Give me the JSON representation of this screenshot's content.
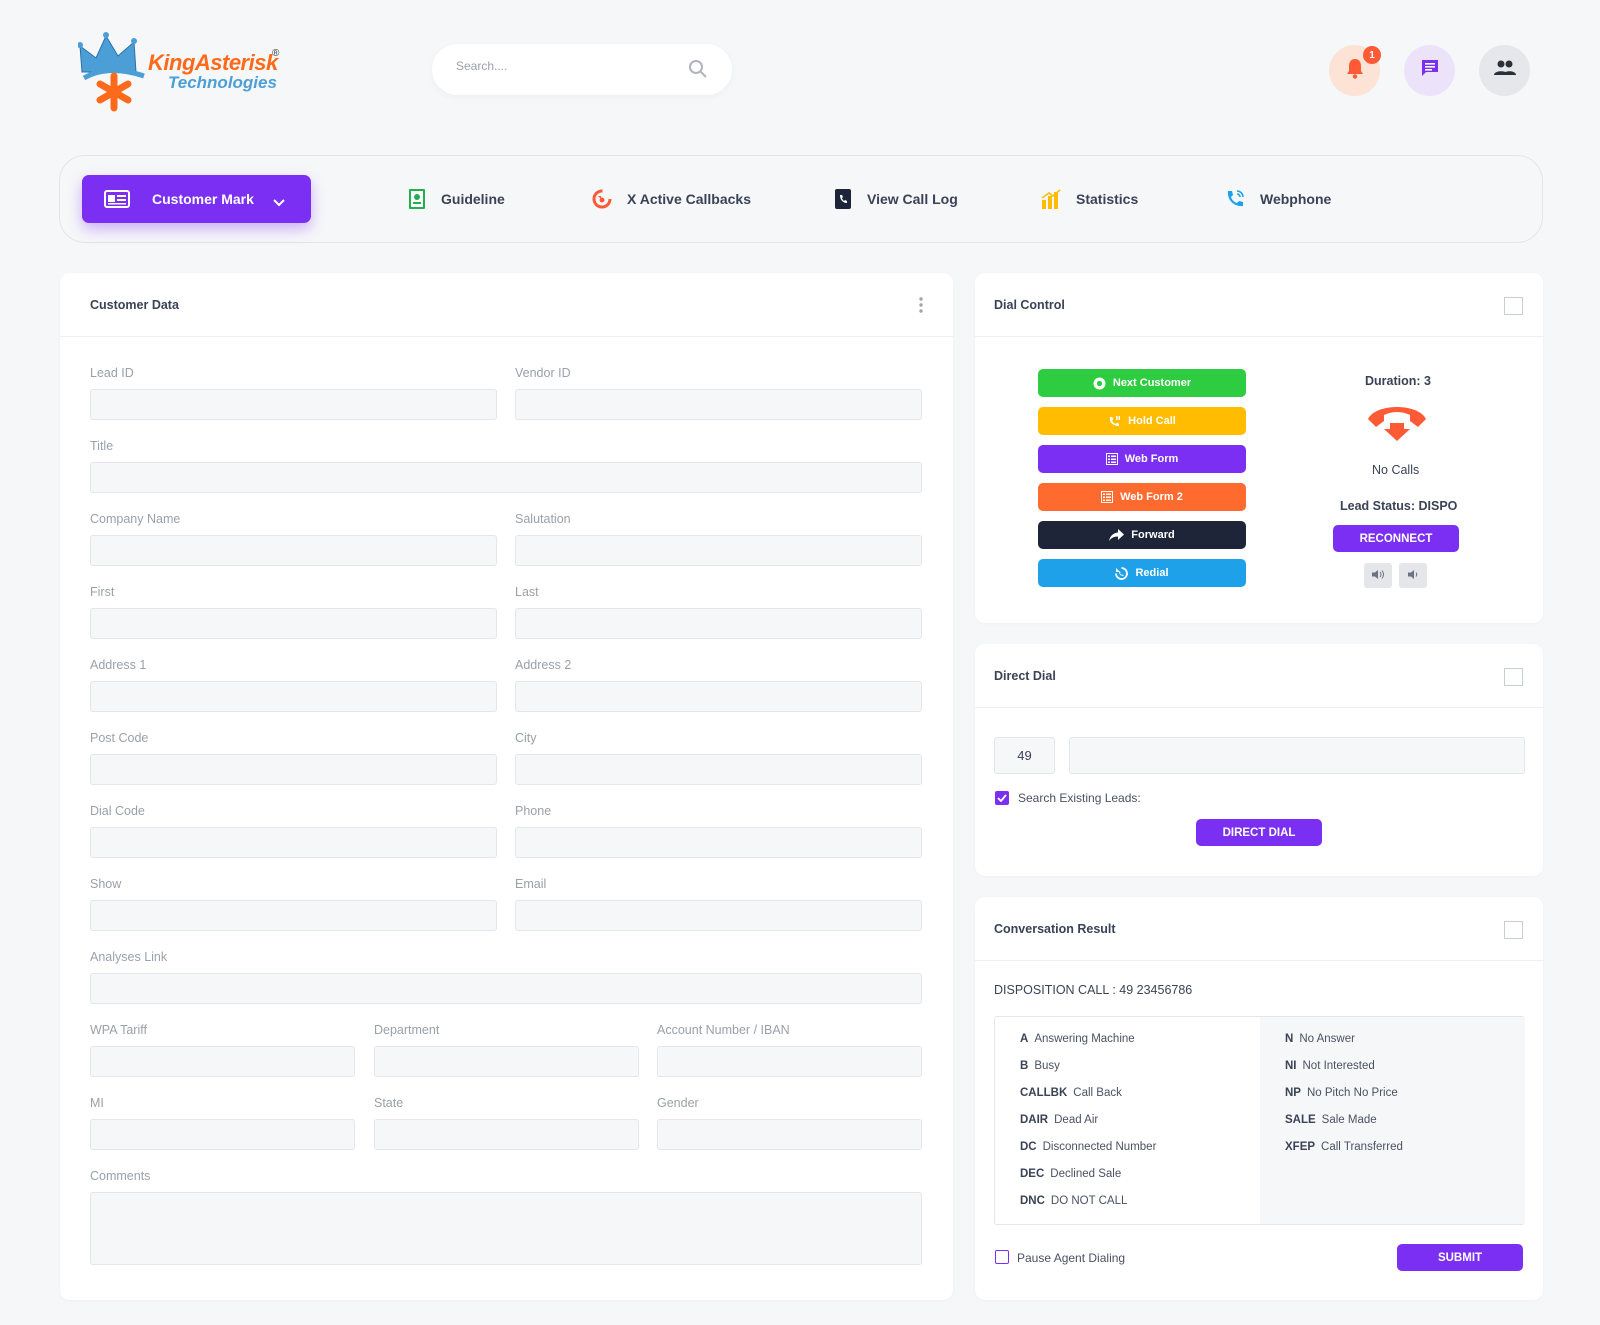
{
  "brand": {
    "name_line1": "KingAsterisk",
    "name_line2": "Technologies",
    "registered": "®"
  },
  "search": {
    "placeholder": "Search...."
  },
  "notifications": {
    "count": "1"
  },
  "nav": {
    "primary": "Customer Mark",
    "items": [
      "Guideline",
      "X Active Callbacks",
      "View Call Log",
      "Statistics",
      "Webphone"
    ]
  },
  "customer_data": {
    "title": "Customer Data",
    "fields": {
      "lead_id": "Lead ID",
      "vendor_id": "Vendor ID",
      "title": "Title",
      "company": "Company Name",
      "salutation": "Salutation",
      "first": "First",
      "last": "Last",
      "address1": "Address 1",
      "address2": "Address 2",
      "post_code": "Post Code",
      "city": "City",
      "dial_code": "Dial Code",
      "phone": "Phone",
      "show": "Show",
      "email": "Email",
      "analyses": "Analyses Link",
      "wpa": "WPA Tariff",
      "department": "Department",
      "account": "Account Number / IBAN",
      "mi": "MI",
      "state": "State",
      "gender": "Gender",
      "comments": "Comments"
    }
  },
  "dial_control": {
    "title": "Dial Control",
    "buttons": {
      "next": "Next Customer",
      "hold": "Hold Call",
      "webform": "Web Form",
      "webform2": "Web Form 2",
      "forward": "Forward",
      "redial": "Redial"
    },
    "duration": "Duration: 3",
    "no_calls": "No Calls",
    "lead_status": "Lead Status: DISPO",
    "reconnect": "RECONNECT"
  },
  "direct_dial": {
    "title": "Direct Dial",
    "code": "49",
    "search_existing": "Search Existing Leads:",
    "button": "DIRECT DIAL"
  },
  "conversation": {
    "title": "Conversation Result",
    "disposition": "DISPOSITION CALL : 49 23456786",
    "left": [
      {
        "code": "A",
        "label": "Answering Machine"
      },
      {
        "code": "B",
        "label": "Busy"
      },
      {
        "code": "CALLBK",
        "label": "Call Back"
      },
      {
        "code": "DAIR",
        "label": "Dead Air"
      },
      {
        "code": "DC",
        "label": "Disconnected Number"
      },
      {
        "code": "DEC",
        "label": "Declined Sale"
      },
      {
        "code": "DNC",
        "label": "DO NOT CALL"
      }
    ],
    "right": [
      {
        "code": "N",
        "label": "No Answer"
      },
      {
        "code": "NI",
        "label": "Not Interested"
      },
      {
        "code": "NP",
        "label": "No Pitch No Price"
      },
      {
        "code": "SALE",
        "label": "Sale Made"
      },
      {
        "code": "XFEP",
        "label": "Call Transferred"
      }
    ],
    "pause": "Pause Agent Dialing",
    "submit": "SUBMIT"
  },
  "colors": {
    "accent": "#7b2ff2",
    "green": "#2ecc40",
    "amber": "#ffbc00",
    "orange": "#ff6a2f",
    "dark": "#1e2538",
    "blue": "#1ea1e8"
  }
}
